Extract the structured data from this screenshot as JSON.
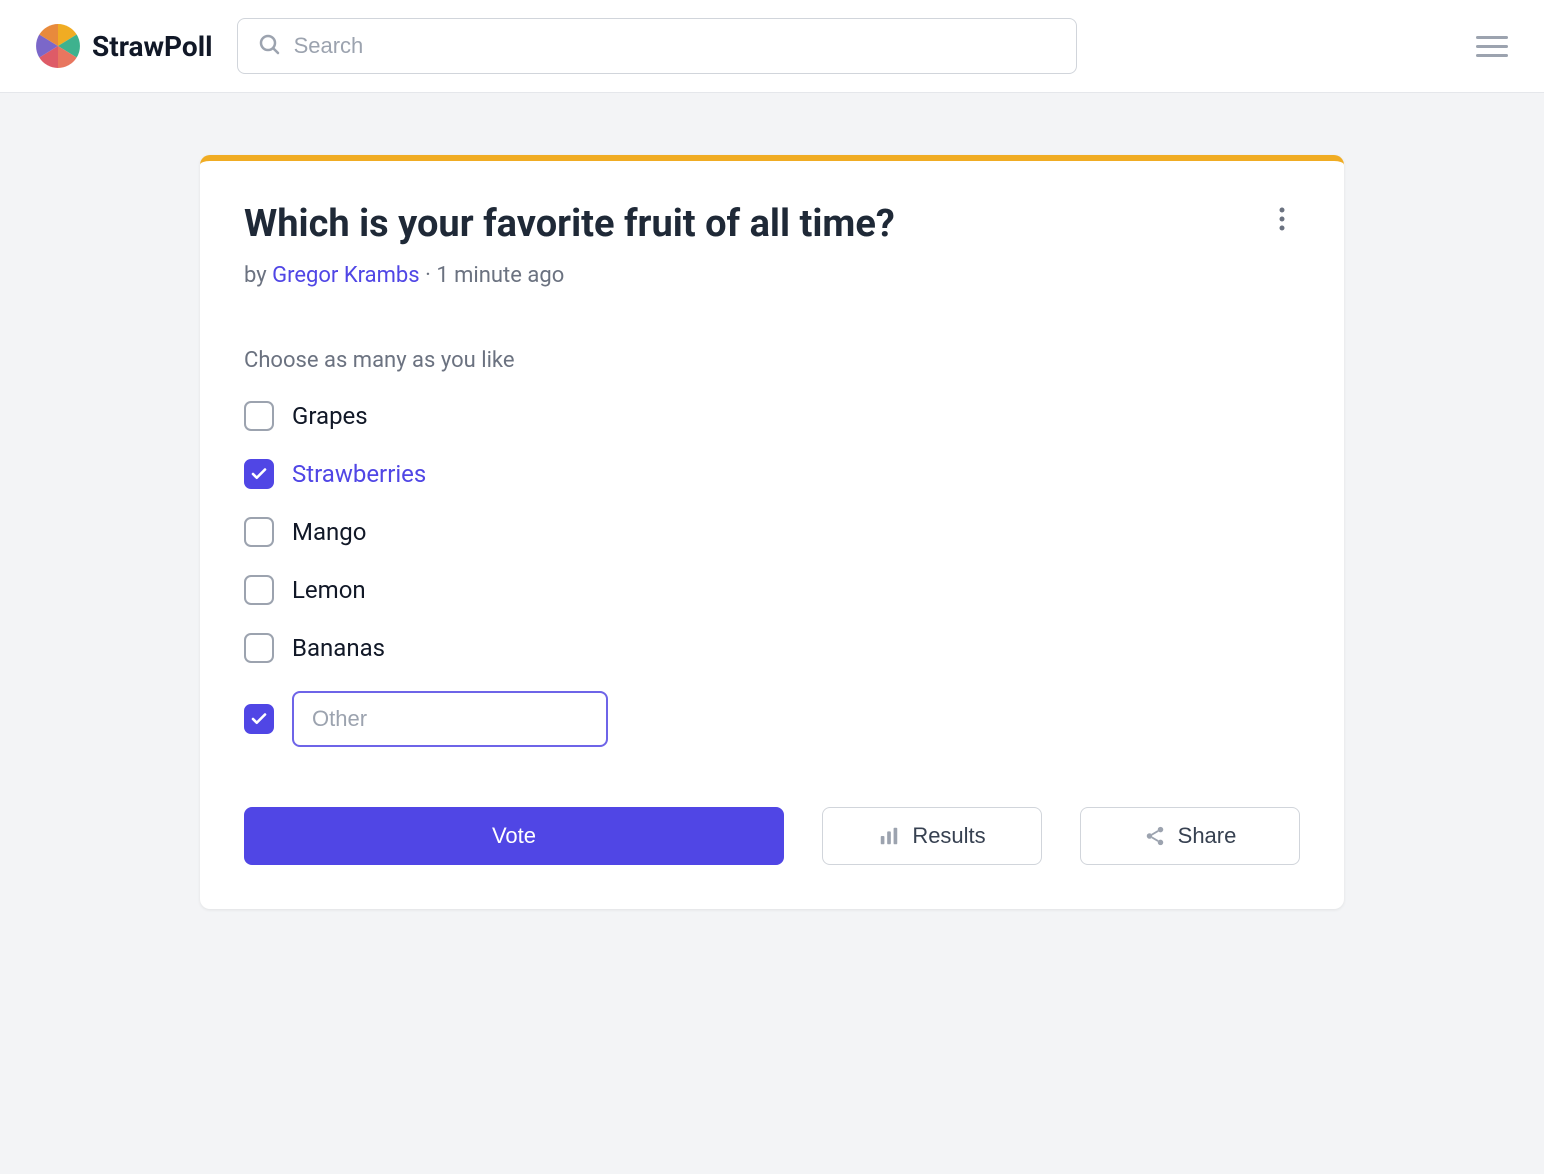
{
  "header": {
    "brand": "StrawPoll",
    "search_placeholder": "Search"
  },
  "poll": {
    "title": "Which is your favorite fruit of all time?",
    "by_prefix": "by ",
    "author": "Gregor Krambs",
    "timestamp": "1 minute ago",
    "instruction": "Choose as many as you like",
    "options": [
      {
        "label": "Grapes",
        "checked": false
      },
      {
        "label": "Strawberries",
        "checked": true
      },
      {
        "label": "Mango",
        "checked": false
      },
      {
        "label": "Lemon",
        "checked": false
      },
      {
        "label": "Bananas",
        "checked": false
      }
    ],
    "other": {
      "checked": true,
      "placeholder": "Other",
      "value": ""
    }
  },
  "actions": {
    "vote": "Vote",
    "results": "Results",
    "share": "Share"
  }
}
